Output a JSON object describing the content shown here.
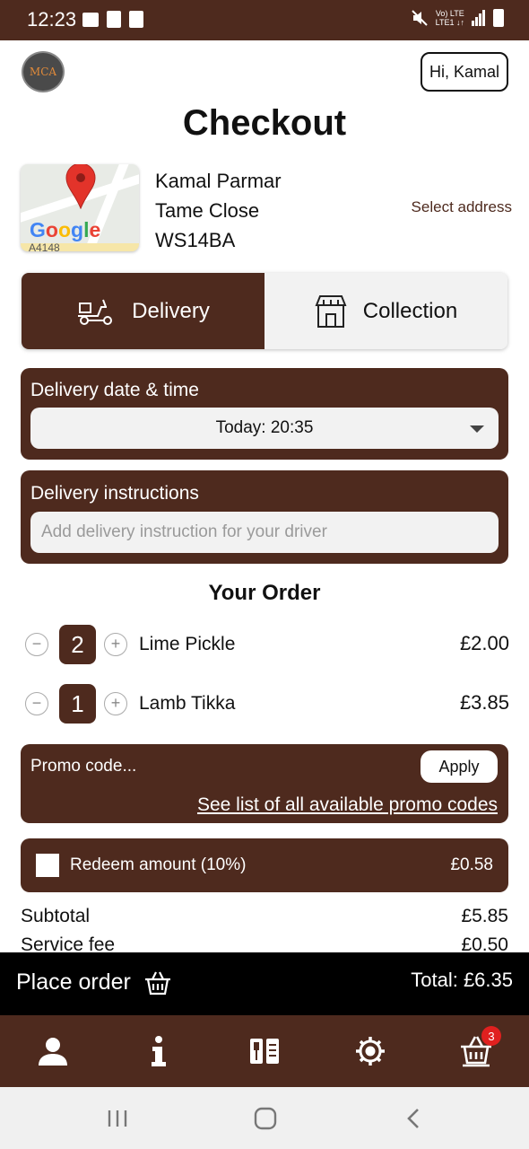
{
  "status_bar": {
    "time": "12:23",
    "network": "Vo) LTE\nLTE1"
  },
  "header": {
    "logo_text": "MCA",
    "greeting": "Hi, Kamal",
    "title": "Checkout"
  },
  "map": {
    "brand": "Google",
    "road_label": "A4148"
  },
  "address": {
    "name": "Kamal Parmar",
    "street": "Tame Close",
    "postcode": "WS14BA",
    "select_label": "Select address"
  },
  "mode_toggle": {
    "delivery_label": "Delivery",
    "collection_label": "Collection",
    "selected": "Delivery"
  },
  "delivery_time": {
    "label": "Delivery date & time",
    "value": "Today: 20:35"
  },
  "instructions": {
    "label": "Delivery instructions",
    "placeholder": "Add delivery instruction for your driver"
  },
  "order": {
    "title": "Your Order",
    "items": [
      {
        "qty": "2",
        "name": "Lime Pickle",
        "price": "£2.00"
      },
      {
        "qty": "1",
        "name": "Lamb Tikka",
        "price": "£3.85"
      }
    ]
  },
  "promo": {
    "placeholder": "Promo code...",
    "apply_label": "Apply",
    "link_text": "See list of all available promo codes"
  },
  "redeem": {
    "label": "Redeem amount (10%)",
    "amount": "£0.58",
    "checked": false
  },
  "summary": [
    {
      "label": "Subtotal",
      "value": "£5.85"
    },
    {
      "label": "Service fee",
      "value": "£0.50"
    }
  ],
  "place_order": {
    "label": "Place order",
    "total": "Total: £6.35"
  },
  "bottom_nav": {
    "items": [
      "account-icon",
      "info-icon",
      "menu-icon",
      "settings-icon",
      "basket-icon"
    ],
    "basket_badge": "3"
  },
  "colors": {
    "brand_brown": "#4e2a1e",
    "badge_red": "#e0201f",
    "place_bar": "#000000"
  }
}
